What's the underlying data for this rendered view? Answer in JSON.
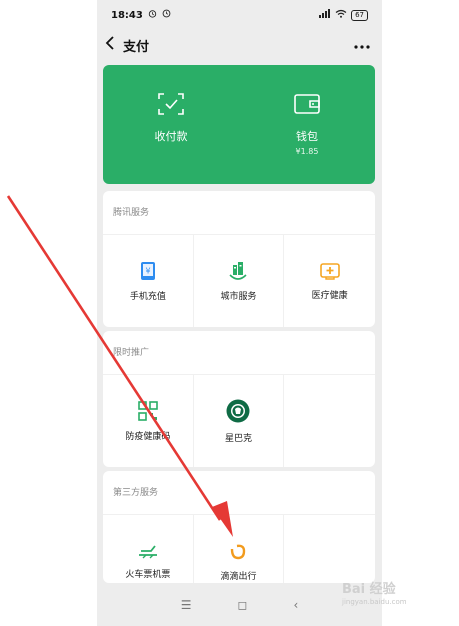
{
  "status_bar": {
    "time": "18:43",
    "signal": "5G",
    "battery": "67"
  },
  "nav": {
    "title": "支付"
  },
  "pay_card": {
    "color": "#2aae67",
    "items": [
      {
        "label": "收付款",
        "icon": "scan-pay-icon"
      },
      {
        "label": "钱包",
        "sub": "¥1.85",
        "icon": "wallet-icon"
      }
    ]
  },
  "sections": [
    {
      "title": "腾讯服务",
      "items": [
        {
          "label": "手机充值",
          "icon": "phone-recharge-icon"
        },
        {
          "label": "城市服务",
          "icon": "city-service-icon"
        },
        {
          "label": "医疗健康",
          "icon": "medical-health-icon"
        }
      ]
    },
    {
      "title": "限时推广",
      "items": [
        {
          "label": "防疫健康码",
          "icon": "health-code-icon"
        },
        {
          "label": "星巴克",
          "icon": "starbucks-icon"
        }
      ]
    },
    {
      "title": "第三方服务",
      "items": [
        {
          "label": "火车票机票",
          "icon": "train-ticket-icon"
        },
        {
          "label": "滴滴出行",
          "icon": "didi-icon"
        }
      ]
    }
  ],
  "bottom_nav": {
    "menu": "☰",
    "home": "◻",
    "back": "‹"
  },
  "watermark": {
    "text": "Bai 经验",
    "url": "jingyan.baidu.com"
  },
  "annotation_color": "#e53935"
}
